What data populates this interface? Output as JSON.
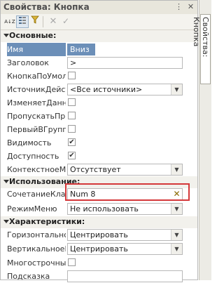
{
  "window": {
    "title": "Свойства: Кнопка",
    "side_tab_label": "Свойства: Кнопка"
  },
  "toolbar": {
    "buttons": [
      "sort-alpha-icon",
      "categorized-icon",
      "filter-icon",
      "delete-icon",
      "check-icon"
    ],
    "sort_label": "A↓Z"
  },
  "sections": {
    "main": "Основные:",
    "usage": "Использование:",
    "characteristics": "Характеристики:"
  },
  "props": {
    "name": {
      "label": "Имя",
      "value": "Вниз"
    },
    "header": {
      "label": "Заголовок",
      "value": ">"
    },
    "default_btn": {
      "label": "КнопкаПоУмолч",
      "checked": false
    },
    "source": {
      "label": "ИсточникДейст",
      "value": "<Все источники>"
    },
    "changes": {
      "label": "ИзменяетДанн",
      "checked": false
    },
    "skip": {
      "label": "ПропускатьПри",
      "checked": false
    },
    "first_group": {
      "label": "ПервыйВГруппе",
      "checked": false
    },
    "visible": {
      "label": "Видимость",
      "checked": true
    },
    "enabled": {
      "label": "Доступность",
      "checked": true
    },
    "context": {
      "label": "КонтекстноеМе",
      "value": "Отсутствует"
    },
    "shortcut": {
      "label": "СочетаниеКлав",
      "value": "Num 8"
    },
    "menu_mode": {
      "label": "РежимМеню",
      "value": "Не использовать"
    },
    "h_align": {
      "label": "Горизонтальное",
      "value": "Центрировать"
    },
    "v_align": {
      "label": "ВертикальноеП",
      "value": "Центрировать"
    },
    "multiline": {
      "label": "Многострочный",
      "checked": false
    },
    "tooltip": {
      "label": "Подсказка",
      "value": ""
    }
  },
  "colors": {
    "selection": "#6c8fb8",
    "highlight_box": "#d4383a"
  }
}
